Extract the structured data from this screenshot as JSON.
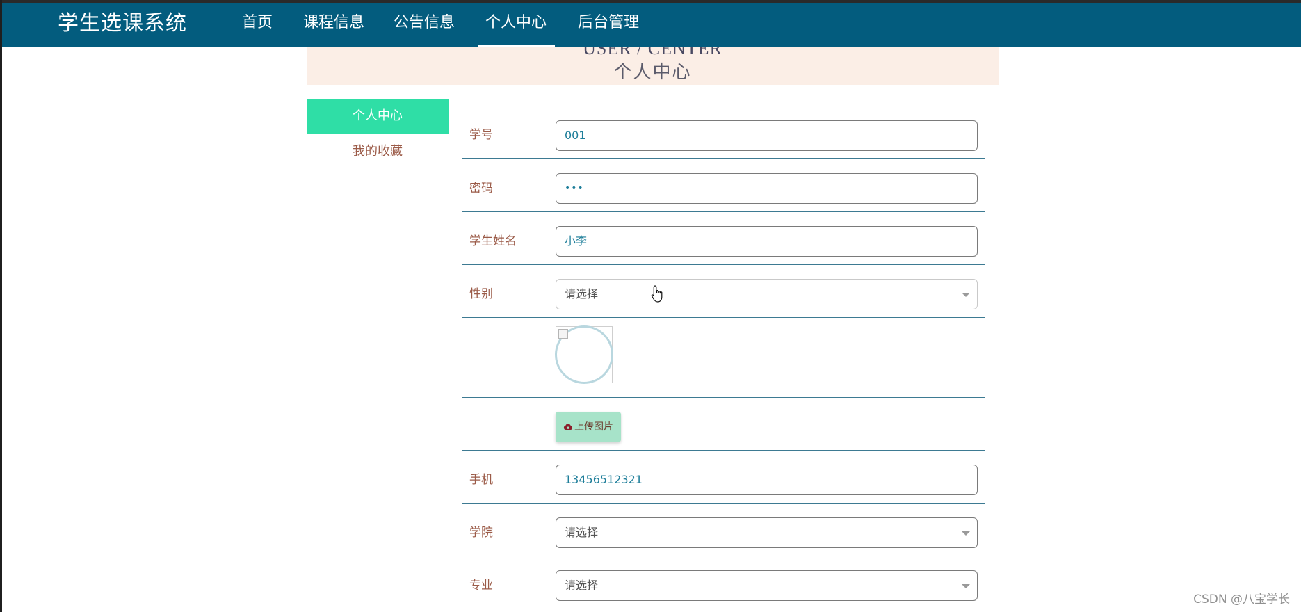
{
  "app": {
    "brand": "学生选课系统"
  },
  "nav": {
    "items": [
      {
        "label": "首页",
        "active": false
      },
      {
        "label": "课程信息",
        "active": false
      },
      {
        "label": "公告信息",
        "active": false
      },
      {
        "label": "个人中心",
        "active": true
      },
      {
        "label": "后台管理",
        "active": false
      }
    ]
  },
  "banner": {
    "en": "USER / CENTER",
    "cn": "个人中心"
  },
  "sidebar": {
    "items": [
      {
        "label": "个人中心",
        "active": true
      },
      {
        "label": "我的收藏",
        "active": false
      }
    ]
  },
  "form": {
    "student_id": {
      "label": "学号",
      "value": "001"
    },
    "password": {
      "label": "密码",
      "value": "•••"
    },
    "name": {
      "label": "学生姓名",
      "value": "小李"
    },
    "gender": {
      "label": "性别",
      "placeholder": "请选择"
    },
    "avatar": {
      "label": ""
    },
    "upload": {
      "label": "上传图片",
      "icon": "cloud-upload-icon"
    },
    "phone": {
      "label": "手机",
      "value": "13456512321"
    },
    "college": {
      "label": "学院",
      "placeholder": "请选择"
    },
    "major": {
      "label": "专业",
      "placeholder": "请选择"
    }
  },
  "watermark": "CSDN @八宝学长",
  "colors": {
    "navbar": "#035c7e",
    "sidebar_active": "#2fdea6",
    "banner_bg": "#fbeee6",
    "label": "#9b5b48",
    "upload_button": "#a7e3c9"
  }
}
